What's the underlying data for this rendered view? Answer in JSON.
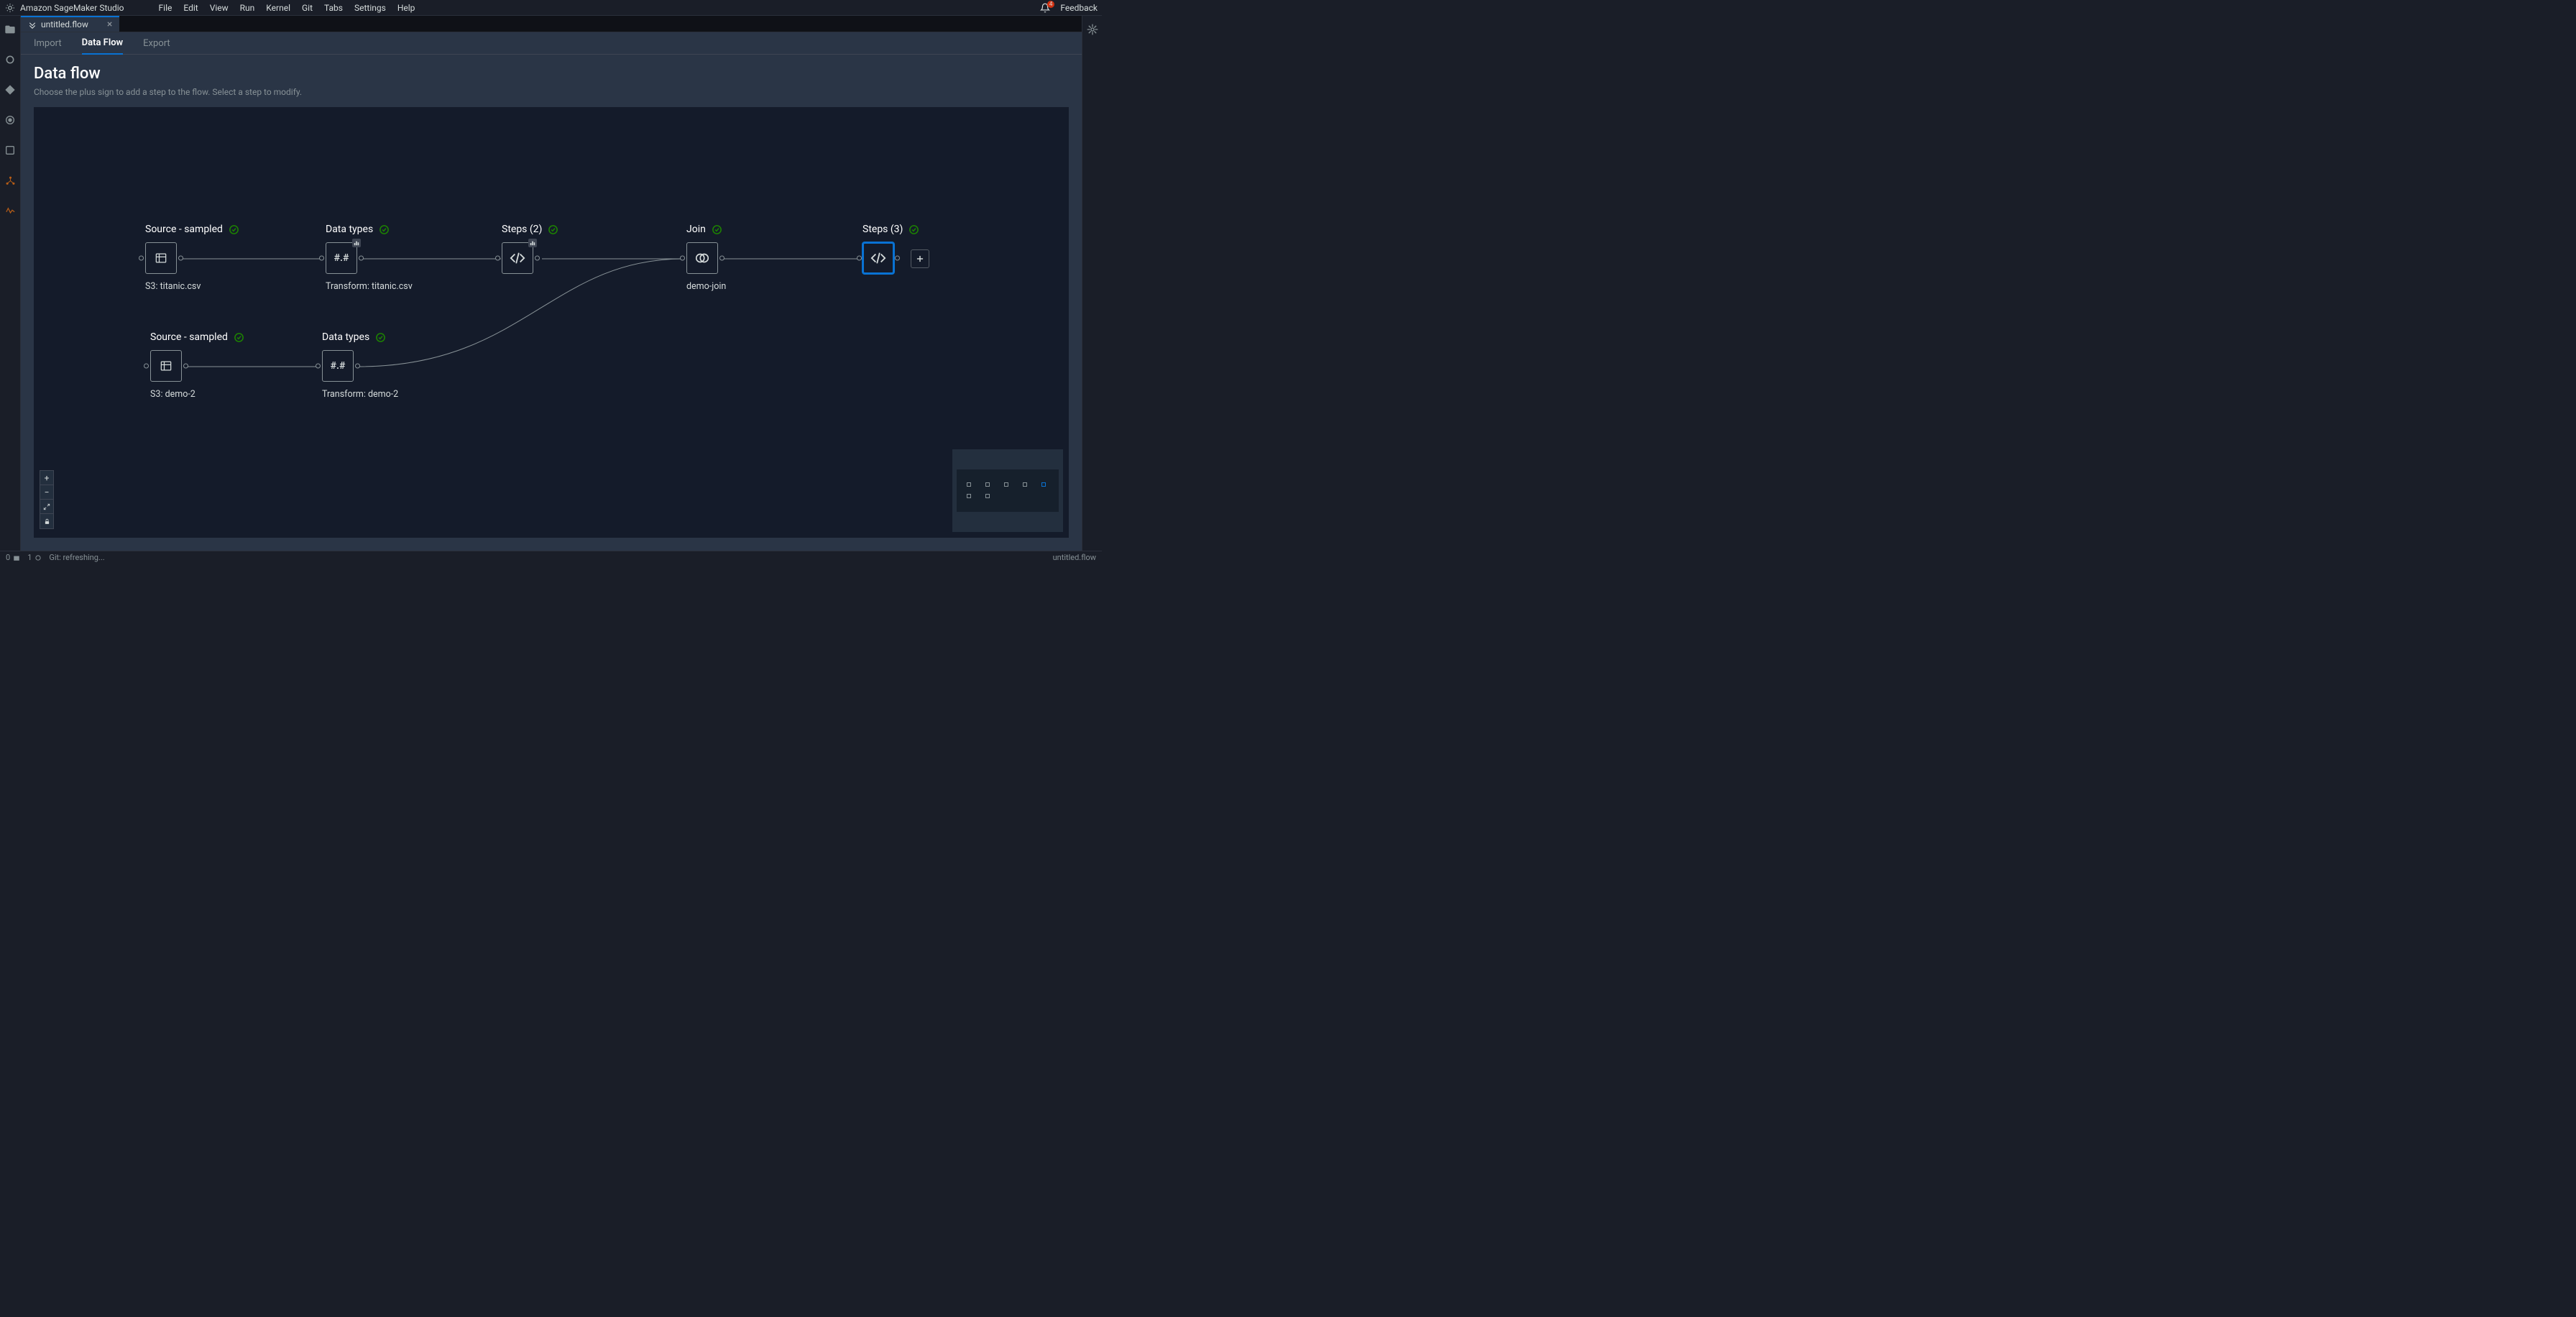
{
  "app": {
    "title": "Amazon SageMaker Studio"
  },
  "menu": [
    "File",
    "Edit",
    "View",
    "Run",
    "Kernel",
    "Git",
    "Tabs",
    "Settings",
    "Help"
  ],
  "top_right": {
    "feedback": "Feedback",
    "bell_count": "4"
  },
  "file_tab": {
    "name": "untitled.flow"
  },
  "sub_tabs": {
    "import": "Import",
    "data_flow": "Data Flow",
    "export": "Export"
  },
  "page": {
    "title": "Data flow",
    "subtitle": "Choose the plus sign to add a step to the flow. Select a step to modify."
  },
  "nodes": {
    "source1": {
      "title": "Source - sampled",
      "footer": "S3: titanic.csv"
    },
    "types1": {
      "title": "Data types",
      "footer": "Transform: titanic.csv",
      "icon_text": "#.#"
    },
    "steps2": {
      "title": "Steps (2)",
      "footer": ""
    },
    "join": {
      "title": "Join",
      "footer": "demo-join"
    },
    "steps3": {
      "title": "Steps (3)",
      "footer": ""
    },
    "source2": {
      "title": "Source - sampled",
      "footer": "S3: demo-2"
    },
    "types2": {
      "title": "Data types",
      "footer": "Transform: demo-2",
      "icon_text": "#.#"
    }
  },
  "status": {
    "open_tabs": "0",
    "terminals": "1",
    "git": "Git: refreshing...",
    "filename": "untitled.flow"
  }
}
